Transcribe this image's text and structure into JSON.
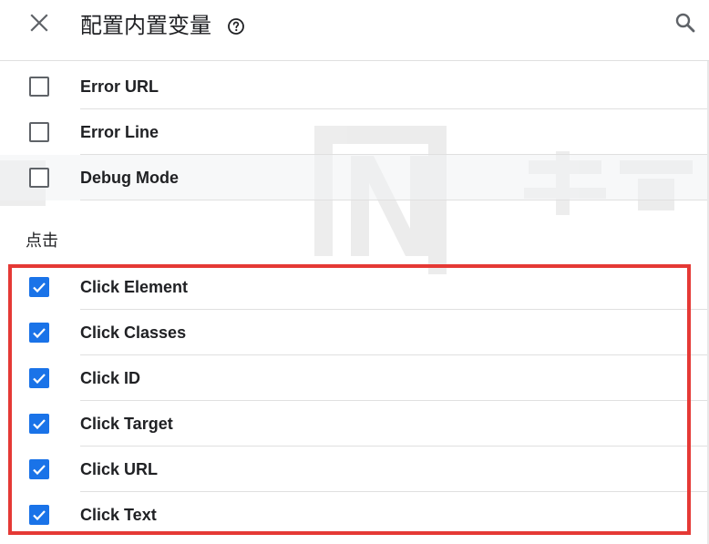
{
  "header": {
    "title": "配置内置变量",
    "close_icon": "close-icon",
    "help_icon": "help-circle-icon",
    "search_icon": "search-icon"
  },
  "error_items": [
    {
      "label": "Error URL",
      "checked": false
    },
    {
      "label": "Error Line",
      "checked": false
    },
    {
      "label": "Debug Mode",
      "checked": false
    }
  ],
  "click_section": {
    "title": "点击",
    "items": [
      {
        "label": "Click Element",
        "checked": true
      },
      {
        "label": "Click Classes",
        "checked": true
      },
      {
        "label": "Click ID",
        "checked": true
      },
      {
        "label": "Click Target",
        "checked": true
      },
      {
        "label": "Click URL",
        "checked": true
      },
      {
        "label": "Click Text",
        "checked": true
      }
    ]
  },
  "colors": {
    "checkbox_checked": "#1a73e8",
    "highlight_border": "#e53935",
    "divider": "#e0e0e0"
  }
}
